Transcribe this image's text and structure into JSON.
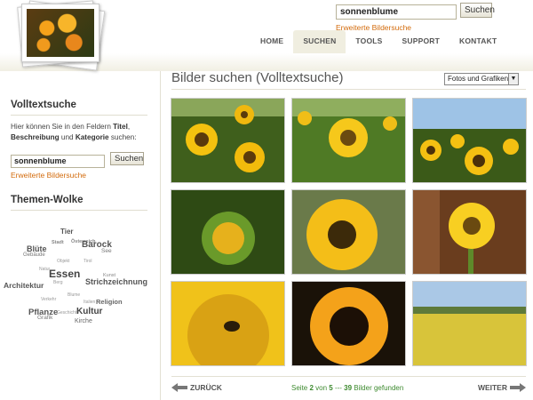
{
  "header": {
    "search_value": "sonnenblume",
    "search_button": "Suchen",
    "advanced_link": "Erweiterte Bildersuche",
    "nav": [
      {
        "label": "HOME",
        "active": false
      },
      {
        "label": "SUCHEN",
        "active": true
      },
      {
        "label": "TOOLS",
        "active": false
      },
      {
        "label": "SUPPORT",
        "active": false
      },
      {
        "label": "KONTAKT",
        "active": false
      }
    ]
  },
  "sidebar": {
    "fulltext_title": "Volltextsuche",
    "intro_prefix": "Hier können Sie in den Feldern ",
    "intro_field1": "Titel",
    "intro_sep1": ", ",
    "intro_field2": "Beschreibung",
    "intro_sep2": " und ",
    "intro_field3": "Kategorie",
    "intro_suffix": " suchen:",
    "search_value": "sonnenblume",
    "search_button": "Suchen",
    "advanced_link": "Erweiterte Bildersuche",
    "cloud_title": "Themen-Wolke",
    "tags": [
      "Tier",
      "Stadt",
      "Österreich",
      "Blüte",
      "Barock",
      "Gebäude",
      "See",
      "Objekt",
      "Tirol",
      "Natur",
      "Essen",
      "Kunst",
      "Berg",
      "Architektur",
      "Strichzeichnung",
      "Blume",
      "Verkehr",
      "Religion",
      "Italien",
      "Pflanze",
      "Geschichte",
      "Kultur",
      "Grafik",
      "Kirche"
    ]
  },
  "main": {
    "title": "Bilder suchen (Volltextsuche)",
    "filter_selected": "Fotos und Grafiken",
    "pager": {
      "back": "ZURÜCK",
      "next": "WEITER",
      "info_prefix": "Seite ",
      "page": "2",
      "info_mid": " von ",
      "pages": "5",
      "info_sep": " --- ",
      "count": "39",
      "info_suffix": " Bilder gefunden"
    }
  },
  "colors": {
    "accent_orange": "#d36b0c",
    "pager_green": "#3d8a2f",
    "nav_active_bg": "#f0eee0"
  }
}
